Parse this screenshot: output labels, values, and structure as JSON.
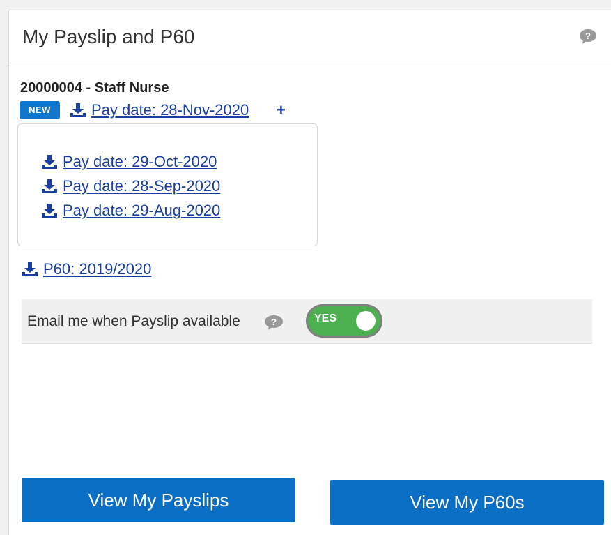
{
  "panel": {
    "title": "My Payslip and P60"
  },
  "employee": {
    "title": "20000004  - Staff Nurse"
  },
  "latest": {
    "badge": "NEW",
    "link": "Pay date: 28-Nov-2020",
    "expand": "+"
  },
  "history": [
    {
      "label": "Pay date: 29-Oct-2020"
    },
    {
      "label": "Pay date: 28-Sep-2020"
    },
    {
      "label": "Pay date: 29-Aug-2020"
    }
  ],
  "p60": {
    "link": "P60: 2019/2020"
  },
  "email": {
    "label": "Email me when Payslip available",
    "toggle_text": "YES",
    "enabled": true
  },
  "buttons": {
    "payslips": "View My Payslips",
    "p60s": "View My P60s"
  },
  "colors": {
    "link": "#1a3fa0",
    "button": "#0a6fc4",
    "badge": "#1177cc",
    "toggle_on": "#4caf50"
  },
  "icons": {
    "download": "download-icon",
    "help": "speech-bubble-help-icon"
  }
}
